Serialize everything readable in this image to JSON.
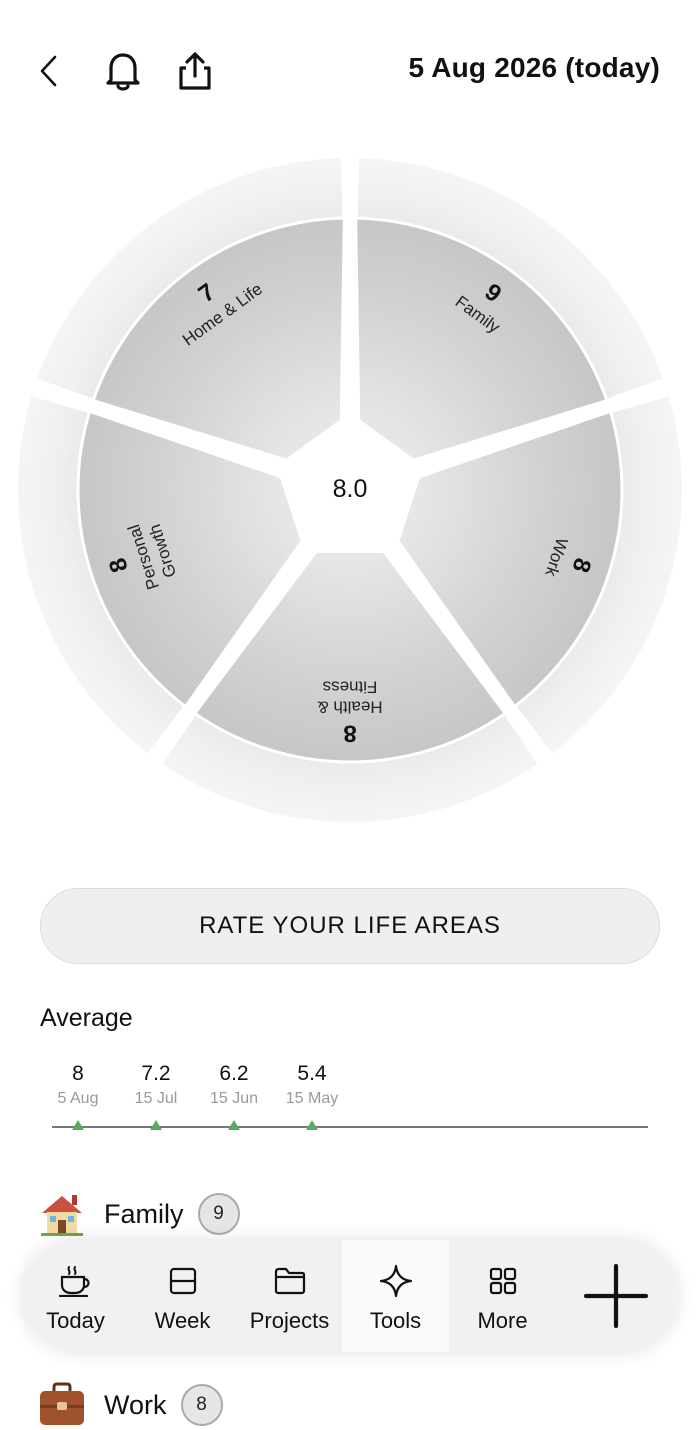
{
  "header": {
    "date": "5 Aug 2026 (today)"
  },
  "wheel": {
    "center_value": "8.0",
    "segments": [
      {
        "label": "Family",
        "score": "9"
      },
      {
        "label": "Work",
        "score": "8"
      },
      {
        "label": "Health & Fitness",
        "score": "8"
      },
      {
        "label": "Personal Growth",
        "score": "8"
      },
      {
        "label": "Home & Life",
        "score": "7"
      }
    ]
  },
  "rate_button": "RATE YOUR LIFE AREAS",
  "average": {
    "title": "Average",
    "points": [
      {
        "value": "8",
        "date": "5 Aug"
      },
      {
        "value": "7.2",
        "date": "15 Jul"
      },
      {
        "value": "6.2",
        "date": "15 Jun"
      },
      {
        "value": "5.4",
        "date": "15 May"
      }
    ]
  },
  "areas": [
    {
      "name": "Family",
      "score": "9",
      "icon": "house-icon"
    },
    {
      "name": "Work",
      "score": "8",
      "icon": "briefcase-icon"
    }
  ],
  "tabbar": {
    "tabs": [
      {
        "label": "Today",
        "icon": "cup-icon"
      },
      {
        "label": "Week",
        "icon": "calendar-week-icon"
      },
      {
        "label": "Projects",
        "icon": "folder-icon"
      },
      {
        "label": "Tools",
        "icon": "sparkle-icon"
      },
      {
        "label": "More",
        "icon": "grid-icon"
      }
    ],
    "active": "Tools",
    "add_icon": "plus-icon"
  },
  "colors": {
    "segment_fill": "#d2d2d2",
    "outer_ring": "#f2f2f2",
    "trend_marker": "#5aaa5e"
  }
}
